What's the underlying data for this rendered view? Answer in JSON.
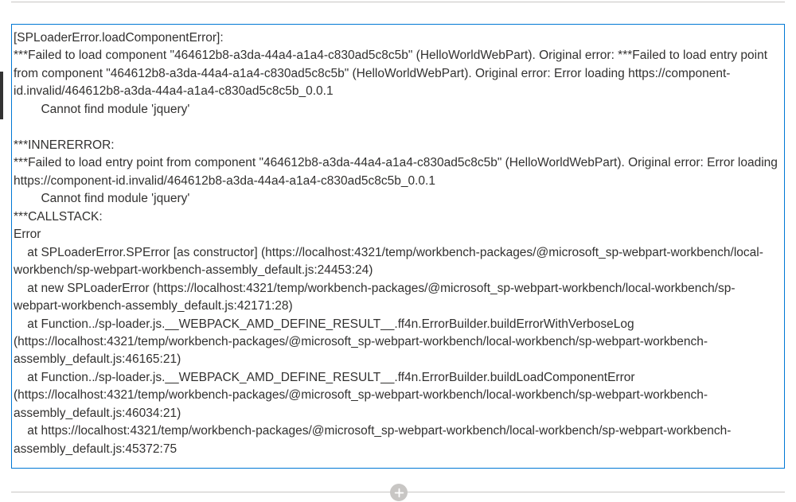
{
  "error": {
    "header": "[SPLoaderError.loadComponentError]:",
    "mainError": "***Failed to load component \"464612b8-a3da-44a4-a1a4-c830ad5c8c5b\" (HelloWorldWebPart). Original error: ***Failed to load entry point from component \"464612b8-a3da-44a4-a1a4-c830ad5c8c5b\" (HelloWorldWebPart). Original error: Error loading https://component-id.invalid/464612b8-a3da-44a4-a1a4-c830ad5c8c5b_0.0.1",
    "mainErrorDetail": "        Cannot find module 'jquery'",
    "blank1": "",
    "innerErrorHeader": "***INNERERROR:",
    "innerError": "***Failed to load entry point from component \"464612b8-a3da-44a4-a1a4-c830ad5c8c5b\" (HelloWorldWebPart). Original error: Error loading https://component-id.invalid/464612b8-a3da-44a4-a1a4-c830ad5c8c5b_0.0.1",
    "innerErrorDetail": "        Cannot find module 'jquery'",
    "callstackHeader": "***CALLSTACK:",
    "callstackError": "Error",
    "stack1": "    at SPLoaderError.SPError [as constructor] (https://localhost:4321/temp/workbench-packages/@microsoft_sp-webpart-workbench/local-workbench/sp-webpart-workbench-assembly_default.js:24453:24)",
    "stack2": "    at new SPLoaderError (https://localhost:4321/temp/workbench-packages/@microsoft_sp-webpart-workbench/local-workbench/sp-webpart-workbench-assembly_default.js:42171:28)",
    "stack3": "    at Function../sp-loader.js.__WEBPACK_AMD_DEFINE_RESULT__.ff4n.ErrorBuilder.buildErrorWithVerboseLog (https://localhost:4321/temp/workbench-packages/@microsoft_sp-webpart-workbench/local-workbench/sp-webpart-workbench-assembly_default.js:46165:21)",
    "stack4": "    at Function../sp-loader.js.__WEBPACK_AMD_DEFINE_RESULT__.ff4n.ErrorBuilder.buildLoadComponentError (https://localhost:4321/temp/workbench-packages/@microsoft_sp-webpart-workbench/local-workbench/sp-webpart-workbench-assembly_default.js:46034:21)",
    "stack5": "    at https://localhost:4321/temp/workbench-packages/@microsoft_sp-webpart-workbench/local-workbench/sp-webpart-workbench-assembly_default.js:45372:75"
  },
  "colors": {
    "border": "#0078d4",
    "text": "#323130",
    "divider": "#c8c6c4",
    "addButton": "#c8c6c4"
  }
}
